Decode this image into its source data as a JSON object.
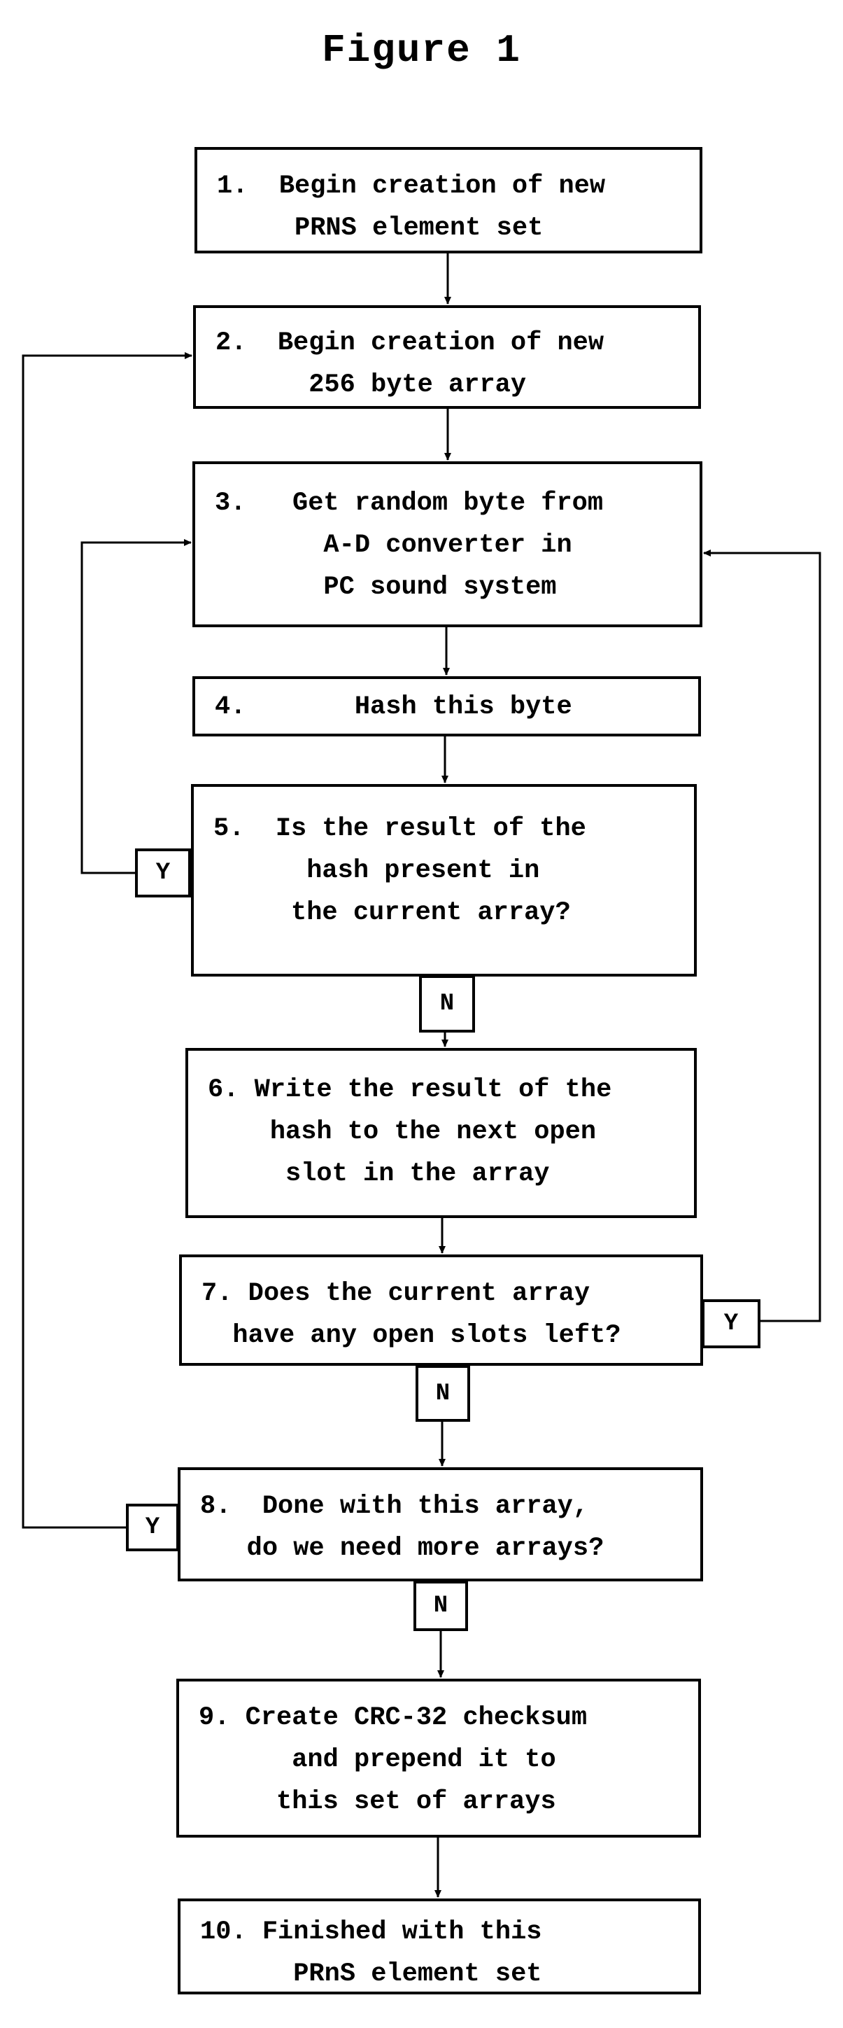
{
  "title": "Figure 1",
  "steps": [
    {
      "id": 1,
      "lines": [
        "1.  Begin creation of new",
        "     PRNS element set"
      ]
    },
    {
      "id": 2,
      "lines": [
        "2.  Begin creation of new",
        "      256 byte array"
      ]
    },
    {
      "id": 3,
      "lines": [
        "3.   Get random byte from",
        "       A-D converter in",
        "       PC sound system"
      ]
    },
    {
      "id": 4,
      "lines": [
        "4.       Hash this byte"
      ]
    },
    {
      "id": 5,
      "lines": [
        "5.  Is the result of the",
        "      hash present in",
        "     the current array?"
      ]
    },
    {
      "id": 6,
      "lines": [
        "6. Write the result of the",
        "    hash to the next open",
        "     slot in the array"
      ]
    },
    {
      "id": 7,
      "lines": [
        "7. Does the current array",
        "  have any open slots left?"
      ]
    },
    {
      "id": 8,
      "lines": [
        "8.  Done with this array,",
        "   do we need more arrays?"
      ]
    },
    {
      "id": 9,
      "lines": [
        "9. Create CRC-32 checksum",
        "      and prepend it to",
        "     this set of arrays"
      ]
    },
    {
      "id": 10,
      "lines": [
        "10. Finished with this",
        "      PRnS element set"
      ]
    }
  ],
  "branch_labels": {
    "step5_yes": "Y",
    "step5_no": "N",
    "step7_yes": "Y",
    "step7_no": "N",
    "step8_yes": "Y",
    "step8_no": "N"
  },
  "edges": [
    {
      "from": 1,
      "to": 2
    },
    {
      "from": 2,
      "to": 3
    },
    {
      "from": 3,
      "to": 4
    },
    {
      "from": 4,
      "to": 5
    },
    {
      "from": 5,
      "to": 3,
      "label": "Y"
    },
    {
      "from": 5,
      "to": 6,
      "label": "N"
    },
    {
      "from": 6,
      "to": 7
    },
    {
      "from": 7,
      "to": 3,
      "label": "Y"
    },
    {
      "from": 7,
      "to": 8,
      "label": "N"
    },
    {
      "from": 8,
      "to": 2,
      "label": "Y"
    },
    {
      "from": 8,
      "to": 9,
      "label": "N"
    },
    {
      "from": 9,
      "to": 10
    }
  ],
  "colors": {
    "ink": "#000000",
    "paper": "#ffffff"
  }
}
